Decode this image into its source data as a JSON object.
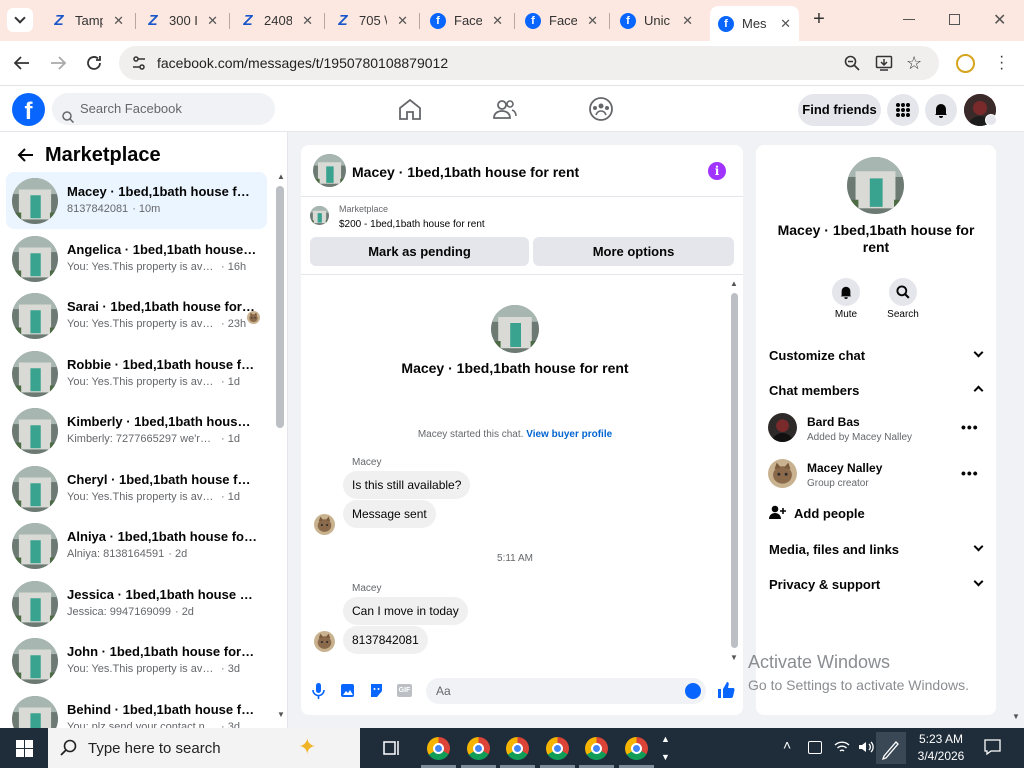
{
  "browser": {
    "tabs": [
      {
        "label": "Tamp",
        "icon": "zoho-icon"
      },
      {
        "label": "300 I",
        "icon": "zoho-icon"
      },
      {
        "label": "2408",
        "icon": "zoho-icon"
      },
      {
        "label": "705 \\",
        "icon": "zoho-icon"
      },
      {
        "label": "Face",
        "icon": "facebook-icon"
      },
      {
        "label": "Face",
        "icon": "facebook-icon"
      },
      {
        "label": "Unic",
        "icon": "facebook-icon"
      },
      {
        "label": "Mes",
        "icon": "facebook-icon",
        "active": true
      }
    ],
    "url": "facebook.com/messages/t/1950780108879012"
  },
  "fb": {
    "logo": "f",
    "search_placeholder": "Search Facebook",
    "find_friends": "Find friends"
  },
  "left": {
    "title": "Marketplace",
    "conversations": [
      {
        "name": "Macey · 1bed,1bath house for rent",
        "preview": "8137842081",
        "time": "· 10m",
        "selected": true
      },
      {
        "name": "Angelica · 1bed,1bath house for rent",
        "preview": "You: Yes.This property is available for rent",
        "time": "· 16h"
      },
      {
        "name": "Sarai · 1bed,1bath house for rent",
        "preview": "You: Yes.This property is available for rent",
        "time": "· 23h",
        "seen_avatar": true
      },
      {
        "name": "Robbie · 1bed,1bath house for rent",
        "preview": "You: Yes.This property is available for rent",
        "time": "· 1d"
      },
      {
        "name": "Kimberly · 1bed,1bath house for rent",
        "preview": "Kimberly: 7277665297 we're is it located",
        "time": "· 1d"
      },
      {
        "name": "Cheryl · 1bed,1bath house for rent",
        "preview": "You: Yes.This property is available for rent",
        "time": "· 1d"
      },
      {
        "name": "Alniya · 1bed,1bath house for rent",
        "preview": "Alniya: 8138164591",
        "time": "· 2d"
      },
      {
        "name": "Jessica · 1bed,1bath house for rent",
        "preview": "Jessica: 9947169099",
        "time": "· 2d"
      },
      {
        "name": "John · 1bed,1bath house for rent",
        "preview": "You: Yes.This property is available for rent",
        "time": "· 3d"
      },
      {
        "name": "Behind · 1bed,1bath house for rent",
        "preview": "You: plz send your contact number",
        "time": "· 3d"
      }
    ]
  },
  "chat": {
    "title": "Macey · 1bed,1bath house for rent",
    "listing_source": "Marketplace",
    "listing": "$200 - 1bed,1bath house for rent",
    "mark_pending": "Mark as pending",
    "more_options": "More options",
    "hero_name": "Macey · 1bed,1bath house for rent",
    "started": "Macey started this chat.",
    "view_profile": "View buyer profile",
    "sender1": "Macey",
    "msg1": "Is this still available?",
    "msg2": "Message sent",
    "timestamp": "5:11 AM",
    "sender2": "Macey",
    "msg3": "Can I move in today",
    "msg4": "8137842081",
    "composer_placeholder": "Aa"
  },
  "right": {
    "name": "Macey · 1bed,1bath house for rent",
    "mute": "Mute",
    "search": "Search",
    "customize": "Customize chat",
    "members_header": "Chat members",
    "members": [
      {
        "name": "Bard Bas",
        "sub": "Added by Macey Nalley"
      },
      {
        "name": "Macey Nalley",
        "sub": "Group creator"
      }
    ],
    "add_people": "Add people",
    "media": "Media, files and links",
    "privacy": "Privacy & support"
  },
  "watermark": {
    "line1": "Activate Windows",
    "line2": "Go to Settings to activate Windows."
  },
  "taskbar": {
    "search_placeholder": "Type here to search",
    "time": "5:23 AM",
    "date": "3/4/2026"
  },
  "colors": {
    "fb_blue": "#0866ff",
    "accent_purple": "#a033ff",
    "tab_bg": "#fce8e0",
    "taskbar": "#1f2d3a"
  }
}
